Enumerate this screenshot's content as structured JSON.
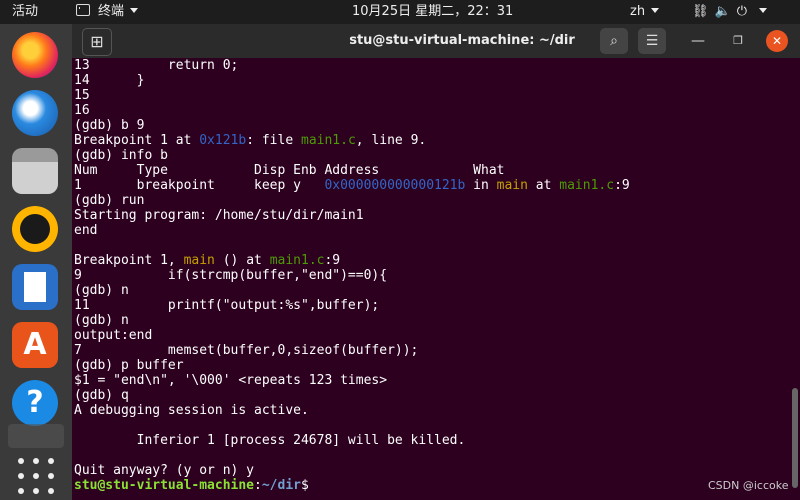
{
  "topbar": {
    "activities": "活动",
    "app_name": "终端",
    "clock": "10月25日 星期二，22：31",
    "lang": "zh",
    "tray_icons": [
      "network-icon",
      "volume-icon",
      "power-icon"
    ]
  },
  "dock": {
    "items": [
      "firefox-icon",
      "thunderbird-icon",
      "files-icon",
      "rhythmbox-icon",
      "writer-icon",
      "software-center-icon",
      "help-icon",
      "trash-icon",
      "show-apps-icon"
    ]
  },
  "window": {
    "title": "stu@stu-virtual-machine: ~/dir"
  },
  "terminal": {
    "lines": [
      [
        {
          "t": "13          return 0;"
        }
      ],
      [
        {
          "t": "14      }"
        }
      ],
      [
        {
          "t": "15"
        }
      ],
      [
        {
          "t": "16"
        }
      ],
      [
        {
          "t": "(gdb) b 9"
        }
      ],
      [
        {
          "t": "Breakpoint 1 at "
        },
        {
          "t": "0x121b",
          "c": "blue"
        },
        {
          "t": ": file "
        },
        {
          "t": "main1.c",
          "c": "green"
        },
        {
          "t": ", line 9."
        }
      ],
      [
        {
          "t": "(gdb) info b"
        }
      ],
      [
        {
          "t": "Num     Type           Disp Enb Address            What"
        }
      ],
      [
        {
          "t": "1       breakpoint     keep y   "
        },
        {
          "t": "0x000000000000121b",
          "c": "blue"
        },
        {
          "t": " in "
        },
        {
          "t": "main",
          "c": "yellow"
        },
        {
          "t": " at "
        },
        {
          "t": "main1.c",
          "c": "green"
        },
        {
          "t": ":9"
        }
      ],
      [
        {
          "t": "(gdb) run"
        }
      ],
      [
        {
          "t": "Starting program: /home/stu/dir/main1"
        }
      ],
      [
        {
          "t": "end"
        }
      ],
      [
        {
          "t": ""
        }
      ],
      [
        {
          "t": "Breakpoint 1, "
        },
        {
          "t": "main",
          "c": "yellow"
        },
        {
          "t": " () at "
        },
        {
          "t": "main1.c",
          "c": "green"
        },
        {
          "t": ":9"
        }
      ],
      [
        {
          "t": "9           if(strcmp(buffer,\"end\")==0){"
        }
      ],
      [
        {
          "t": "(gdb) n"
        }
      ],
      [
        {
          "t": "11          printf(\"output:%s\",buffer);"
        }
      ],
      [
        {
          "t": "(gdb) n"
        }
      ],
      [
        {
          "t": "output:end"
        }
      ],
      [
        {
          "t": "7           memset(buffer,0,sizeof(buffer));"
        }
      ],
      [
        {
          "t": "(gdb) p buffer"
        }
      ],
      [
        {
          "t": "$1 = \"end\\n\", '\\000' <repeats 123 times>"
        }
      ],
      [
        {
          "t": "(gdb) q"
        }
      ],
      [
        {
          "t": "A debugging session is active."
        }
      ],
      [
        {
          "t": ""
        }
      ],
      [
        {
          "t": "        Inferior 1 [process 24678] will be killed."
        }
      ],
      [
        {
          "t": ""
        }
      ],
      [
        {
          "t": "Quit anyway? (y or n) y"
        }
      ],
      [
        {
          "t": "stu@stu-virtual-machine",
          "c": "bgreen"
        },
        {
          "t": ":"
        },
        {
          "t": "~/dir",
          "c": "bblue"
        },
        {
          "t": "$ "
        }
      ]
    ]
  },
  "watermark": "CSDN @iccoke"
}
